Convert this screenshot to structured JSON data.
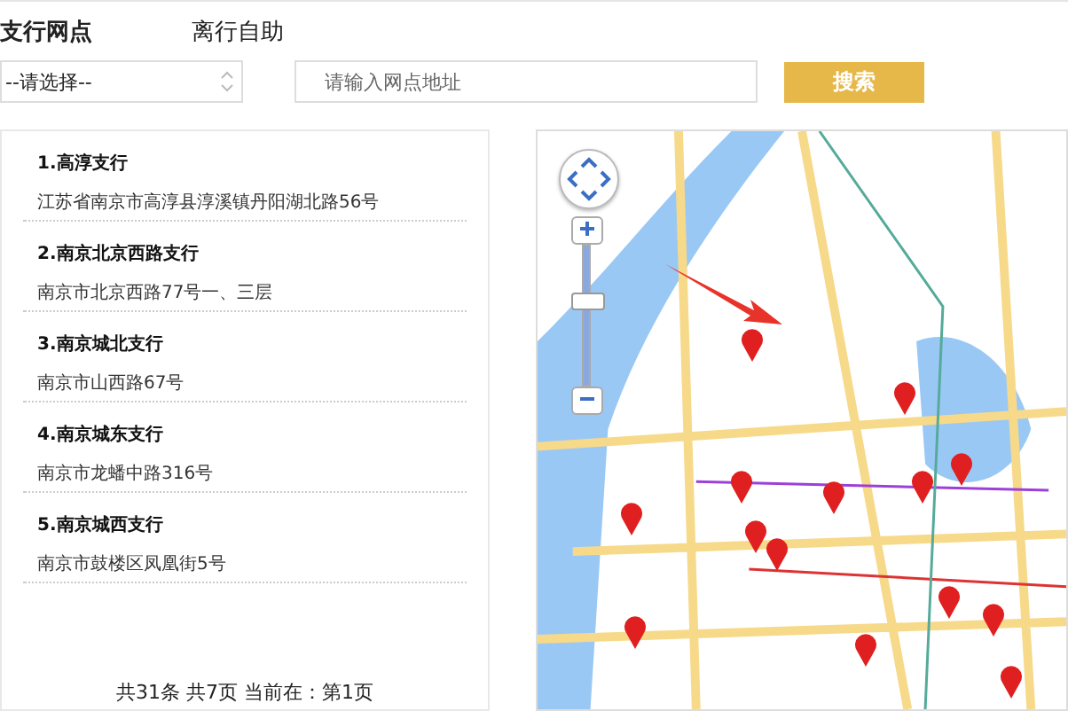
{
  "tabs": [
    {
      "label": "支行网点",
      "selected": true
    },
    {
      "label": "离行自助",
      "selected": false
    }
  ],
  "filter": {
    "select_value": "--请选择--",
    "placeholder": "请输入网点地址",
    "button": "搜索"
  },
  "branches": [
    {
      "name": "1.高淳支行",
      "address": "江苏省南京市高淳县淳溪镇丹阳湖北路56号"
    },
    {
      "name": "2.南京北京西路支行",
      "address": "南京市北京西路77号一、三层"
    },
    {
      "name": "3.南京城北支行",
      "address": "南京市山西路67号"
    },
    {
      "name": "4.南京城东支行",
      "address": "南京市龙蟠中路316号"
    },
    {
      "name": "5.南京城西支行",
      "address": "南京市鼓楼区凤凰街5号"
    }
  ],
  "pagination": "共31条 共7页 当前在：第1页",
  "map": {
    "zoom": {
      "level": 0.6
    }
  }
}
